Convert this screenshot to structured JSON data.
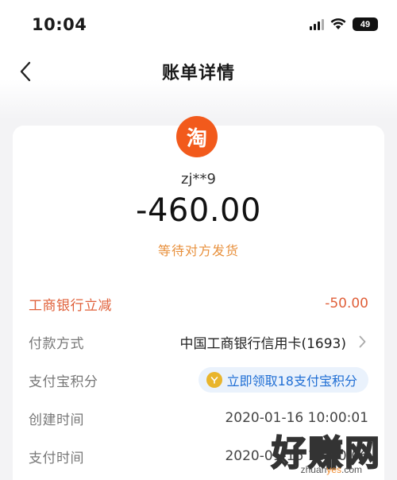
{
  "status_bar": {
    "time": "10:04",
    "battery": "49"
  },
  "nav": {
    "title": "账单详情"
  },
  "merchant": {
    "logo_text": "淘",
    "name": "zj**9"
  },
  "bill": {
    "amount": "-460.00",
    "status": "等待对方发货"
  },
  "rows": [
    {
      "label": "工商银行立减",
      "value": "-50.00"
    },
    {
      "label": "付款方式",
      "value": "中国工商银行信用卡(1693)"
    },
    {
      "label": "支付宝积分",
      "value": "立即领取18支付宝积分"
    },
    {
      "label": "创建时间",
      "value": "2020-01-16 10:00:01"
    },
    {
      "label": "支付时间",
      "value": "2020-01-16 10:00:06"
    }
  ],
  "watermark": {
    "text": "好赚网",
    "url_prefix": "zhuan",
    "url_accent": "yes",
    "url_suffix": ".com"
  },
  "colors": {
    "accent_orange": "#f25a1c",
    "discount_red": "#e0603a",
    "status_orange": "#e8903c",
    "link_blue": "#1f6ed4"
  }
}
